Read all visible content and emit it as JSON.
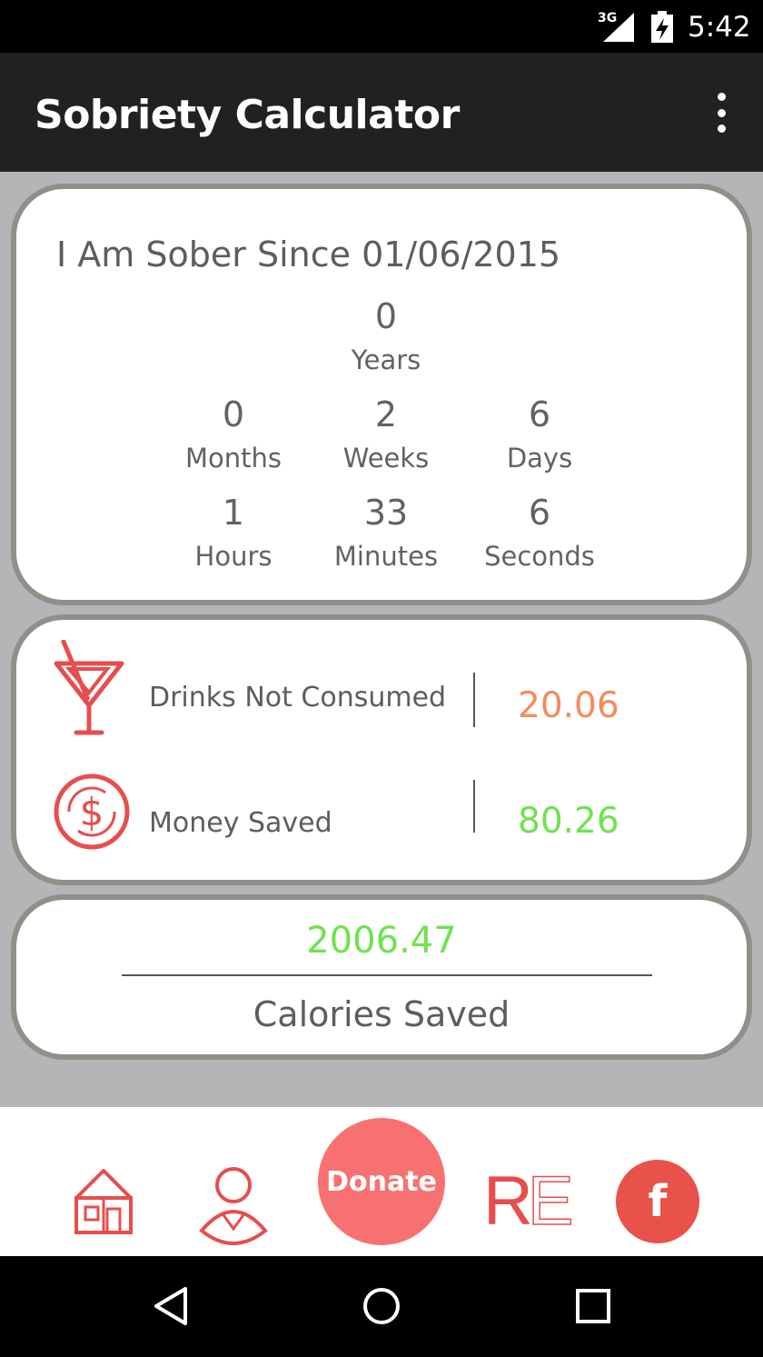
{
  "status_bar": {
    "network": "3G",
    "time": "5:42"
  },
  "app_bar": {
    "title": "Sobriety Calculator"
  },
  "sober_card": {
    "since_text": "I Am Sober Since 01/06/2015",
    "years": {
      "value": "0",
      "label": "Years"
    },
    "months": {
      "value": "0",
      "label": "Months"
    },
    "weeks": {
      "value": "2",
      "label": "Weeks"
    },
    "days": {
      "value": "6",
      "label": "Days"
    },
    "hours": {
      "value": "1",
      "label": "Hours"
    },
    "minutes": {
      "value": "33",
      "label": "Minutes"
    },
    "seconds": {
      "value": "6",
      "label": "Seconds"
    }
  },
  "stats_card": {
    "drinks": {
      "label": "Drinks Not Consumed",
      "value": "20.06",
      "icon": "cocktail-icon",
      "color": "#f48c5a"
    },
    "money": {
      "label": "Money Saved",
      "value": "80.26",
      "icon": "dollar-coin-icon",
      "color": "#6ee34e"
    }
  },
  "calories_card": {
    "value": "2006.47",
    "label": "Calories Saved",
    "color": "#6ee34e"
  },
  "bottom_bar": {
    "home_icon": "home-icon",
    "profile_icon": "profile-icon",
    "donate_label": "Donate",
    "re_logo": {
      "r": "R",
      "e": "E"
    },
    "facebook_label": "f"
  },
  "colors": {
    "accent": "#e84d4d",
    "card_border": "#908f88",
    "background": "#b5b4b7",
    "app_bar": "#212121"
  }
}
